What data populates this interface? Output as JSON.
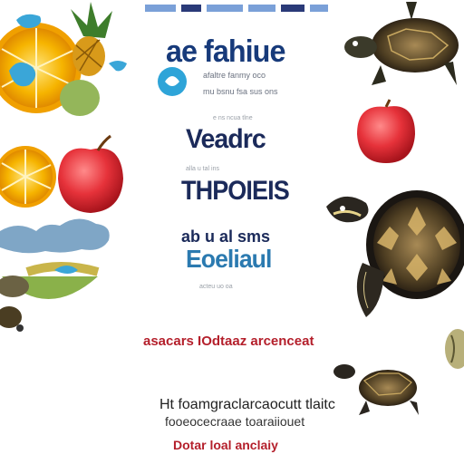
{
  "header": {
    "title": "ae fahiue",
    "subtitle_1": "afaltre fanmy oco",
    "subtitle_2": "mu bsnu fsa sus ons"
  },
  "section_1": {
    "caption": "e ns ncua tlne",
    "heading": "Veadrc",
    "footnote": "alla u tal ins"
  },
  "section_2": {
    "heading": "THPOIEIS"
  },
  "section_3": {
    "stacked": "ab u al sms",
    "heading": "Eoeliaul",
    "footnote": "acteu uo oa"
  },
  "tagline": "asacars   IOdtaaz   arcenceat",
  "body": {
    "line_1": "Ht foamgraclarcaocutt tlaitc",
    "line_2": "fooeocecraae toaraiiouet",
    "line_3": "Dotar loal anclaiy"
  },
  "colors": {
    "navy": "#1b2a5a",
    "blue": "#2b7ab0",
    "red": "#b41f2b"
  }
}
